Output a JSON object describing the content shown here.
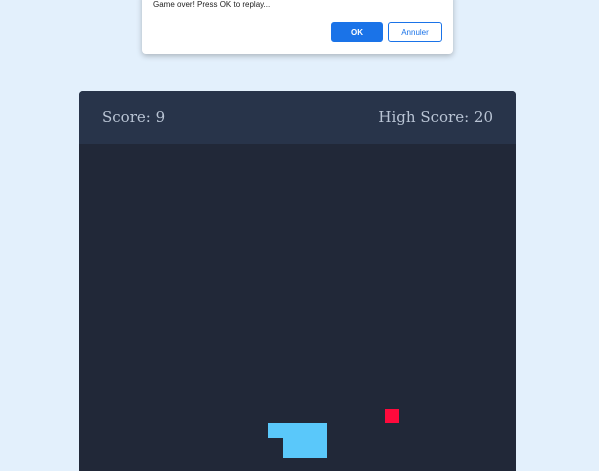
{
  "dialog": {
    "message": "Game over! Press OK to replay...",
    "ok_label": "OK",
    "cancel_label": "Annuler"
  },
  "scoreboard": {
    "score_text": "Score: 9",
    "high_score_text": "High Score: 20"
  },
  "colors": {
    "page_background": "#e3f0fc",
    "board_background": "#212838",
    "scorebar_background": "#28344a",
    "snake": "#5ac8fa",
    "food": "#ff0a3c",
    "button_accent": "#1a73e8"
  }
}
